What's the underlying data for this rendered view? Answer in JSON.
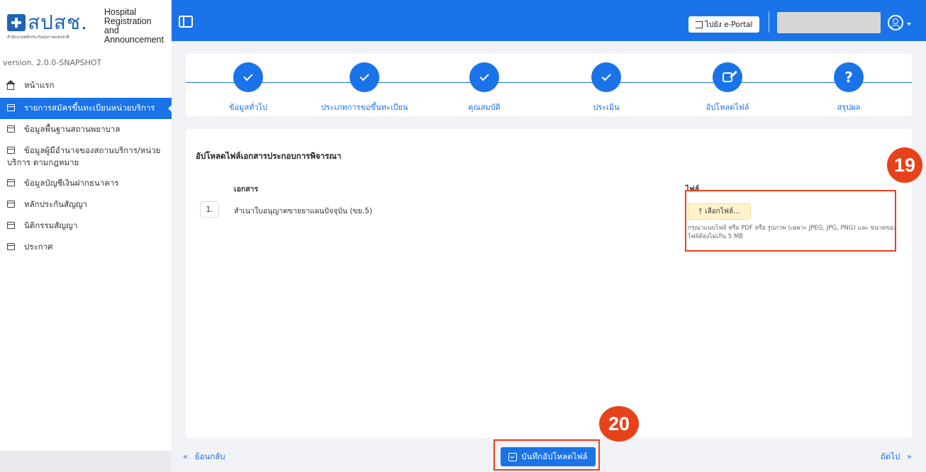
{
  "app": {
    "logo_thai": "สปสช.",
    "logo_sub": "สำนักงานหลักประกันสุขภาพแห่งชาติ",
    "logo_title_1": "Hospital",
    "logo_title_2": "Registration and",
    "logo_title_3": "Announcement",
    "version": "version. 2.0.0-SNAPSHOT"
  },
  "sidebar": {
    "items": [
      {
        "label": "หน้าแรก",
        "icon": "home-icon"
      },
      {
        "label": "รายการสมัครขึ้นทะเบียนหน่วยบริการ",
        "icon": "calendar-icon",
        "active": true
      },
      {
        "label": "ข้อมูลพื้นฐานสถานพยาบาล",
        "icon": "calendar-icon"
      },
      {
        "label": "ข้อมูลผู้มีอำนาจของสถานบริการ/หน่วยบริการ ตามกฎหมาย",
        "icon": "calendar-icon"
      },
      {
        "label": "ข้อมูลบัญชีเงินฝากธนาคาร",
        "icon": "calendar-icon"
      },
      {
        "label": "หลักประกันสัญญา",
        "icon": "calendar-icon"
      },
      {
        "label": "นิติกรรมสัญญา",
        "icon": "calendar-icon"
      },
      {
        "label": "ประกาศ",
        "icon": "calendar-icon"
      }
    ]
  },
  "topbar": {
    "portal_label": "ไปยัง e-Portal"
  },
  "steps": [
    {
      "label": "ข้อมูลทั่วไป",
      "state": "done"
    },
    {
      "label": "ประเภทการขอขึ้นทะเบียน",
      "state": "done"
    },
    {
      "label": "คุณสมบัติ",
      "state": "done"
    },
    {
      "label": "ประเมิน",
      "state": "done"
    },
    {
      "label": "อัปโหลดไฟล์",
      "state": "current",
      "icon": "edit-icon"
    },
    {
      "label": "สรุปผล",
      "state": "pending",
      "symbol": "?"
    }
  ],
  "upload": {
    "title": "อัปโหลดไฟล์เอกสารประกอบการพิจารณา",
    "col_document": "เอกสาร",
    "col_file": "ไฟล์",
    "rows": [
      {
        "num": "1.",
        "name": "สำเนาใบอนุญาตขายยาแผนปัจจุบัน (ขย.5)"
      }
    ],
    "choose_file_label": "เลือกไฟล์...",
    "hint": "กรุณาแนบไฟล์ หรือ PDF หรือ รูปภาพ (เฉพาะ JPEG, JPG, PNG) และ ขนาดของไฟล์ต้องไม่เกิน 5 MB"
  },
  "footer": {
    "back_label": "ย้อนกลับ",
    "save_label": "บันทึกอัปโหลดไฟล์",
    "next_label": "ถัดไป"
  },
  "annotations": {
    "badge_19": "19",
    "badge_20": "20"
  },
  "colors": {
    "primary": "#1a73e8",
    "highlight": "#e8421b"
  }
}
